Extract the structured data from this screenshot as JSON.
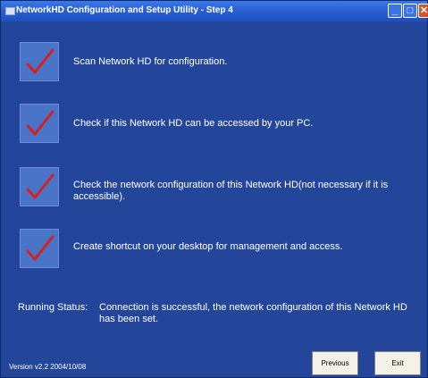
{
  "window": {
    "title": "NetworkHD Configuration and Setup Utility - Step 4"
  },
  "steps": [
    {
      "label": "Scan Network HD for configuration."
    },
    {
      "label": "Check if this Network HD can be accessed by your PC."
    },
    {
      "label": "Check the network configuration of this Network HD(not necessary if it is accessible)."
    },
    {
      "label": "Create shortcut on your desktop for management and access."
    }
  ],
  "status": {
    "label": "Running Status:",
    "text": "Connection is successful, the network configuration of this Network HD has been set."
  },
  "footer": {
    "version": "Version v2.2  2004/10/08",
    "previous_label": "Previous",
    "exit_label": "Exit"
  },
  "colors": {
    "background": "#24469a",
    "titlebar": "#2a5fd0",
    "checkmark": "#d62020"
  }
}
